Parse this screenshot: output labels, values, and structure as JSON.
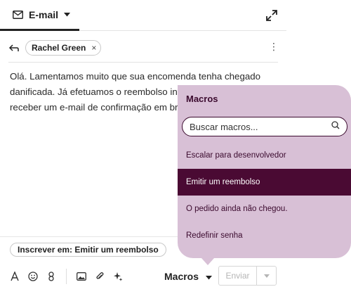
{
  "tab": {
    "label": "E-mail"
  },
  "recipient": {
    "name": "Rachel Green",
    "remove": "×"
  },
  "body": {
    "line1": "Olá. Lamentamos muito que sua encomenda tenha chegado",
    "line2": "danificada. Já efetuamos o reembolso int",
    "line3": "receber um e-mail de confirmação em br"
  },
  "subscribe": {
    "label": "Inscrever em: Emitir um reembolso"
  },
  "toolbar": {
    "macros_label": "Macros",
    "send_label": "Enviar"
  },
  "macros_popover": {
    "title": "Macros",
    "search_placeholder": "Buscar macros...",
    "items": [
      {
        "label": "Escalar para desenvolvedor"
      },
      {
        "label": "Emitir um reembolso"
      },
      {
        "label": "O pedido ainda não chegou."
      },
      {
        "label": "Redefinir senha"
      }
    ],
    "selected_index": 1
  },
  "colors": {
    "popover_bg": "#d8c0d6",
    "accent": "#4a0a33",
    "accent_text": "#3b0a2e"
  }
}
